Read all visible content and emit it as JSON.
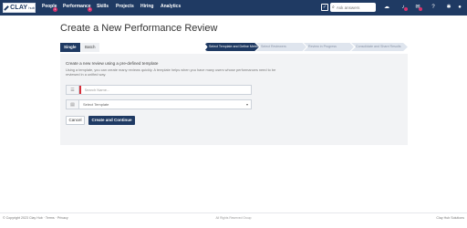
{
  "app": {
    "logo_text": "CLAY",
    "logo_sub": "hub"
  },
  "nav": {
    "items": [
      "People",
      "Performance",
      "Skills",
      "Projects",
      "Hiring",
      "Analytics"
    ],
    "badges": {
      "people": "1",
      "performance": "1"
    },
    "search_placeholder": "Ask answers"
  },
  "icons": {
    "check": "check-square-icon",
    "search": "search-icon",
    "chat": "chat-icon",
    "bell": "bell-icon",
    "mail": "mail-icon",
    "help": "help-icon",
    "gear": "gear-icon",
    "user": "user-icon"
  },
  "page": {
    "title": "Create a New Performance Review"
  },
  "tabs": [
    {
      "label": "Single",
      "active": true
    },
    {
      "label": "Batch",
      "active": false
    }
  ],
  "steps": [
    {
      "label": "Select Template and Define Metrics",
      "active": true
    },
    {
      "label": "Select Reviewers",
      "active": false
    },
    {
      "label": "Review in Progress",
      "active": false
    },
    {
      "label": "Consolidate and Share Results",
      "active": false
    }
  ],
  "form": {
    "heading": "Create a new review using a pre-defined template",
    "description": "Using a template, you can create many reviews quickly. A template helps when you have many users whose performances need to be reviewed in a unified way.",
    "name_placeholder": "Search Name...",
    "template_value": "Select Template",
    "cancel_label": "Cancel",
    "create_label": "Create and Continue"
  },
  "footer": {
    "left": "© Copyright 2023 Clay Hub · Terms · Privacy",
    "center": "All Rights Reserved Group",
    "right": "Clay Hub Solutions"
  },
  "colors": {
    "nav_bg": "#1f3a63",
    "accent": "#1f3a63",
    "badge": "#d6336c",
    "required": "#d62f3a"
  }
}
